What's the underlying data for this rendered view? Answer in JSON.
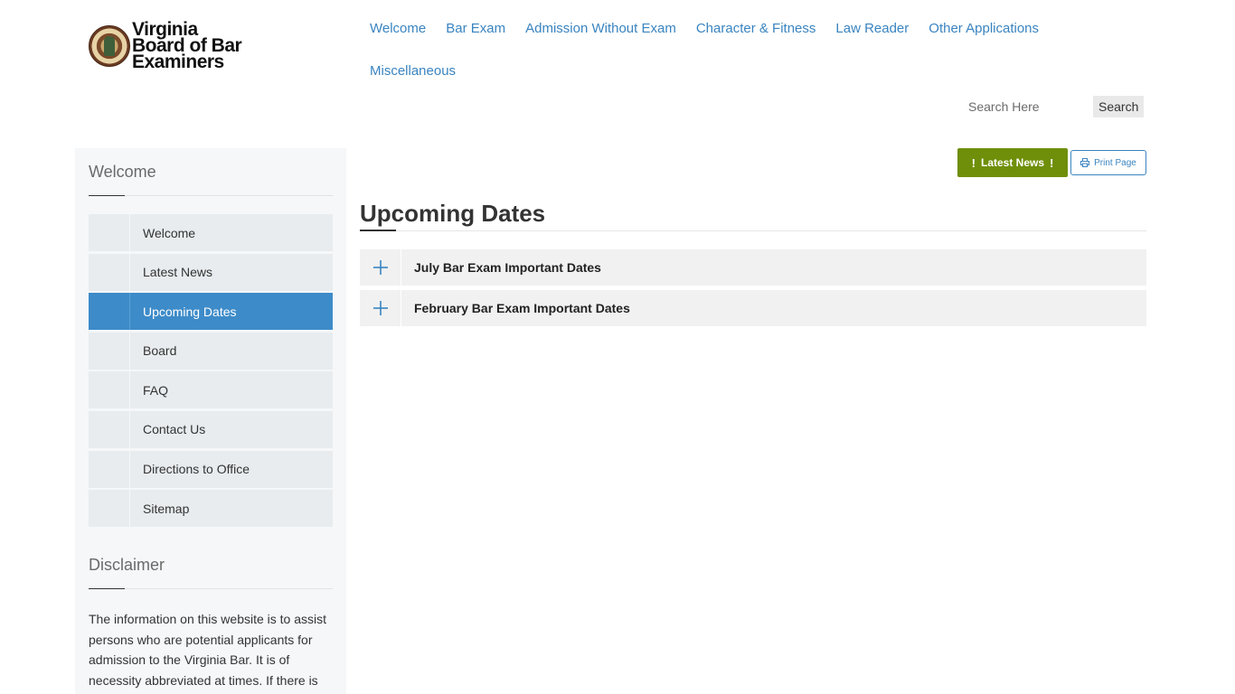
{
  "logo": {
    "line1": "Virginia",
    "line2": "Board of Bar",
    "line3": "Examiners"
  },
  "nav": {
    "items": [
      {
        "label": "Welcome"
      },
      {
        "label": "Bar Exam"
      },
      {
        "label": "Admission Without Exam"
      },
      {
        "label": "Character & Fitness"
      },
      {
        "label": "Law Reader"
      },
      {
        "label": "Other Applications"
      },
      {
        "label": "Miscellaneous"
      }
    ]
  },
  "search": {
    "placeholder": "Search Here",
    "button_label": "Search"
  },
  "sidebar": {
    "heading": "Welcome",
    "items": [
      {
        "label": "Welcome",
        "active": false
      },
      {
        "label": "Latest News",
        "active": false
      },
      {
        "label": "Upcoming Dates",
        "active": true
      },
      {
        "label": "Board",
        "active": false
      },
      {
        "label": "FAQ",
        "active": false
      },
      {
        "label": "Contact Us",
        "active": false
      },
      {
        "label": "Directions to Office",
        "active": false
      },
      {
        "label": "Sitemap",
        "active": false
      }
    ],
    "disclaimer_heading": "Disclaimer",
    "disclaimer_text": "The information on this website is to assist persons who are potential applicants for admission to the Virginia Bar. It is of necessity abbreviated at times. If there is any conflict between any language on this"
  },
  "actions": {
    "latest_news_label": "Latest News",
    "latest_news_mark": "!",
    "print_label": "Print Page"
  },
  "main": {
    "title": "Upcoming Dates",
    "accordion": [
      {
        "label": "July Bar Exam Important Dates"
      },
      {
        "label": "February Bar Exam Important Dates"
      }
    ]
  },
  "colors": {
    "link": "#3a84c0",
    "active_menu": "#3d8bc9",
    "news_button": "#6f8f0a"
  }
}
